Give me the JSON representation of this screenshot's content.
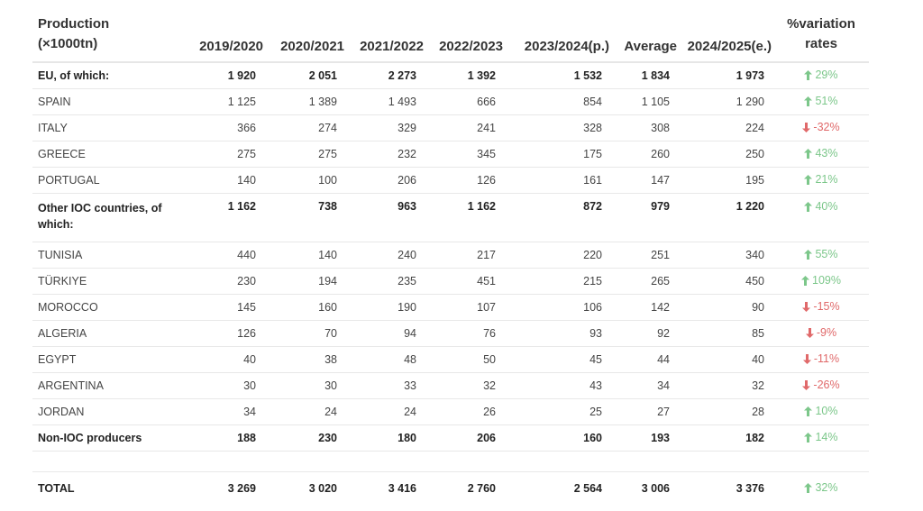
{
  "header": {
    "name_line1": "Production",
    "name_line2": "(×1000tn)",
    "columns": [
      "2019/2020",
      "2020/2021",
      "2021/2022",
      "2022/2023",
      "2023/2024(p.)",
      "Average",
      "2024/2025(e.)"
    ],
    "var_line1": "%variation",
    "var_line2": "rates"
  },
  "colors": {
    "up": "#7cc78a",
    "down": "#e0696a"
  },
  "rows": [
    {
      "name": "EU, of which:",
      "bold": true,
      "values": [
        "1 920",
        "2 051",
        "2 273",
        "1 392",
        "1 532",
        "1 834",
        "1 973"
      ],
      "direction": "up",
      "variation": "29%"
    },
    {
      "name": "SPAIN",
      "bold": false,
      "values": [
        "1 125",
        "1 389",
        "1 493",
        "666",
        "854",
        "1 105",
        "1 290"
      ],
      "direction": "up",
      "variation": "51%"
    },
    {
      "name": "ITALY",
      "bold": false,
      "values": [
        "366",
        "274",
        "329",
        "241",
        "328",
        "308",
        "224"
      ],
      "direction": "down",
      "variation": "-32%"
    },
    {
      "name": "GREECE",
      "bold": false,
      "values": [
        "275",
        "275",
        "232",
        "345",
        "175",
        "260",
        "250"
      ],
      "direction": "up",
      "variation": "43%"
    },
    {
      "name": "PORTUGAL",
      "bold": false,
      "values": [
        "140",
        "100",
        "206",
        "126",
        "161",
        "147",
        "195"
      ],
      "direction": "up",
      "variation": "21%"
    },
    {
      "name": "Other IOC countries, of which:",
      "bold": true,
      "tall": true,
      "values": [
        "1 162",
        "738",
        "963",
        "1 162",
        "872",
        "979",
        "1 220"
      ],
      "direction": "up",
      "variation": "40%"
    },
    {
      "name": "TUNISIA",
      "bold": false,
      "values": [
        "440",
        "140",
        "240",
        "217",
        "220",
        "251",
        "340"
      ],
      "direction": "up",
      "variation": "55%"
    },
    {
      "name": "TÜRKIYE",
      "bold": false,
      "values": [
        "230",
        "194",
        "235",
        "451",
        "215",
        "265",
        "450"
      ],
      "direction": "up",
      "variation": "109%"
    },
    {
      "name": "MOROCCO",
      "bold": false,
      "values": [
        "145",
        "160",
        "190",
        "107",
        "106",
        "142",
        "90"
      ],
      "direction": "down",
      "variation": "-15%"
    },
    {
      "name": "ALGERIA",
      "bold": false,
      "values": [
        "126",
        "70",
        "94",
        "76",
        "93",
        "92",
        "85"
      ],
      "direction": "down",
      "variation": "-9%"
    },
    {
      "name": "EGYPT",
      "bold": false,
      "values": [
        "40",
        "38",
        "48",
        "50",
        "45",
        "44",
        "40"
      ],
      "direction": "down",
      "variation": "-11%"
    },
    {
      "name": "ARGENTINA",
      "bold": false,
      "values": [
        "30",
        "30",
        "33",
        "32",
        "43",
        "34",
        "32"
      ],
      "direction": "down",
      "variation": "-26%"
    },
    {
      "name": "JORDAN",
      "bold": false,
      "values": [
        "34",
        "24",
        "24",
        "26",
        "25",
        "27",
        "28"
      ],
      "direction": "up",
      "variation": "10%"
    },
    {
      "name": "Non-IOC producers",
      "bold": true,
      "values": [
        "188",
        "230",
        "180",
        "206",
        "160",
        "193",
        "182"
      ],
      "direction": "up",
      "variation": "14%"
    }
  ],
  "total": {
    "name": "TOTAL",
    "values": [
      "3 269",
      "3 020",
      "3 416",
      "2 760",
      "2 564",
      "3 006",
      "3 376"
    ],
    "direction": "up",
    "variation": "32%"
  }
}
